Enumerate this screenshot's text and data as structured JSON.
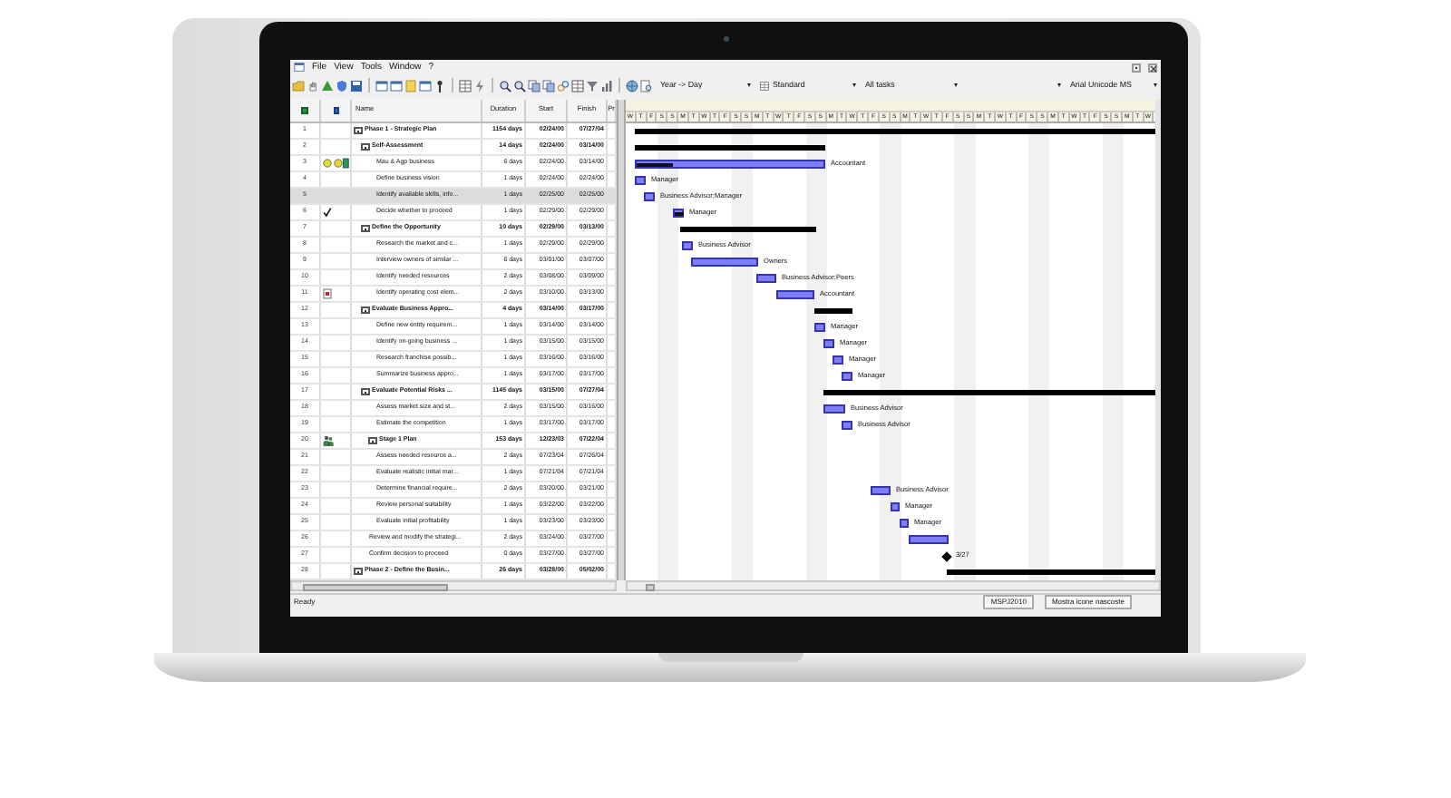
{
  "menu": {
    "items": [
      "File",
      "View",
      "Tools",
      "Window",
      "?"
    ]
  },
  "toolbar": {
    "dropdowns": [
      {
        "kind": "text",
        "value": "Year -> Day"
      },
      {
        "kind": "icon-text",
        "value": "Standard"
      },
      {
        "kind": "text",
        "value": "All tasks"
      },
      {
        "kind": "blank"
      },
      {
        "kind": "text",
        "value": "Arial Unicode MS"
      }
    ]
  },
  "table": {
    "columns": [
      "Name",
      "Duration",
      "Start",
      "Finish",
      "Pr"
    ],
    "rows": [
      {
        "id": "1",
        "name": "Phase 1 - Strategic Plan",
        "duration": "1154 days",
        "start": "02/24/00",
        "finish": "07/27/04",
        "selected": false,
        "expanded": true,
        "bar": {
          "kind": "summary"
        },
        "children": [
          {
            "id": "2",
            "name": "Self-Assessment",
            "duration": "14 days",
            "start": "02/24/00",
            "finish": "03/14/00",
            "selected": false,
            "expanded": true,
            "bar": {
              "kind": "summary"
            },
            "children": [
              {
                "id": "3",
                "name": "Mau & Agp business",
                "duration": "6 days",
                "start": "02/24/00",
                "finish": "03/14/00",
                "selected": false,
                "indicators": [
                  {
                    "kind": "bulb"
                  },
                  {
                    "kind": "bulb"
                  },
                  {
                    "kind": "person"
                  }
                ],
                "bar": {
                  "kind": "task",
                  "level": 0.2,
                  "label": "Accountant"
                }
              },
              {
                "id": "4",
                "name": "Define business vision",
                "duration": "1 days",
                "start": "02/24/00",
                "finish": "02/24/00",
                "selected": false,
                "bar": {
                  "kind": "task",
                  "label": "Manager"
                }
              },
              {
                "id": "5",
                "name": "Identify available skills, info...",
                "duration": "1 days",
                "start": "02/25/00",
                "finish": "02/25/00",
                "selected": true,
                "bar": {
                  "kind": "task",
                  "label": "Business Advisor;Manager"
                }
              },
              {
                "id": "6",
                "name": "Decide whether to proceed",
                "duration": "1 days",
                "start": "02/29/00",
                "finish": "02/29/00",
                "selected": false,
                "indicators": [
                  {
                    "kind": "complete"
                  }
                ],
                "bar": {
                  "kind": "task",
                  "level": 1,
                  "label": "Manager"
                }
              }
            ]
          },
          {
            "id": "7",
            "name": "Define the Opportunity",
            "duration": "10 days",
            "start": "02/29/00",
            "finish": "03/13/00",
            "selected": false,
            "expanded": true,
            "bar": {
              "kind": "summary"
            },
            "children": [
              {
                "id": "8",
                "name": "Research the market and c...",
                "duration": "1 days",
                "start": "02/29/00",
                "finish": "02/29/00",
                "selected": false,
                "bar": {
                  "kind": "task",
                  "label": "Business Advisor"
                }
              },
              {
                "id": "9",
                "name": "Interview owners of similar ...",
                "duration": "6 days",
                "start": "03/01/00",
                "finish": "03/07/00",
                "selected": false,
                "bar": {
                  "kind": "task",
                  "label": "Owners"
                }
              },
              {
                "id": "10",
                "name": "Identify needed resources",
                "duration": "2 days",
                "start": "03/08/00",
                "finish": "03/09/00",
                "selected": false,
                "bar": {
                  "kind": "task",
                  "label": "Business Advisor;Peers"
                }
              },
              {
                "id": "11",
                "name": "Identify operating cost elem...",
                "duration": "2 days",
                "start": "03/10/00",
                "finish": "03/13/00",
                "selected": false,
                "indicators": [
                  {
                    "kind": "note"
                  }
                ],
                "bar": {
                  "kind": "task",
                  "label": "Accountant"
                }
              }
            ]
          },
          {
            "id": "12",
            "name": "Evaluate Business Appro...",
            "duration": "4 days",
            "start": "03/14/00",
            "finish": "03/17/00",
            "selected": false,
            "expanded": true,
            "bar": {
              "kind": "summary"
            },
            "children": [
              {
                "id": "13",
                "name": "Define new entity requirem...",
                "duration": "1 days",
                "start": "03/14/00",
                "finish": "03/14/00",
                "selected": false,
                "bar": {
                  "kind": "task",
                  "label": "Manager"
                }
              },
              {
                "id": "14",
                "name": "Identify on-going business ...",
                "duration": "1 days",
                "start": "03/15/00",
                "finish": "03/15/00",
                "selected": false,
                "bar": {
                  "kind": "task",
                  "label": "Manager"
                }
              },
              {
                "id": "15",
                "name": "Research franchise possib...",
                "duration": "1 days",
                "start": "03/16/00",
                "finish": "03/16/00",
                "selected": false,
                "bar": {
                  "kind": "task",
                  "label": "Manager"
                }
              },
              {
                "id": "16",
                "name": "Summarize business appro...",
                "duration": "1 days",
                "start": "03/17/00",
                "finish": "03/17/00",
                "selected": false,
                "bar": {
                  "kind": "task",
                  "label": "Manager"
                }
              }
            ]
          },
          {
            "id": "17",
            "name": "Evaluate Potential Risks ...",
            "duration": "1145 days",
            "start": "03/15/00",
            "finish": "07/27/04",
            "selected": false,
            "expanded": true,
            "bar": {
              "kind": "summary"
            },
            "children": [
              {
                "id": "18",
                "name": "Assess market size and st...",
                "duration": "2 days",
                "start": "03/15/00",
                "finish": "03/16/00",
                "selected": false,
                "bar": {
                  "kind": "task",
                  "label": "Business Advisor"
                }
              },
              {
                "id": "19",
                "name": "Estimate the competition",
                "duration": "1 days",
                "start": "03/17/00",
                "finish": "03/17/00",
                "selected": false,
                "bar": {
                  "kind": "task",
                  "label": "Business Advisor"
                }
              },
              {
                "id": "20",
                "name": "Stage 1 Plan",
                "duration": "153 days",
                "start": "12/23/03",
                "finish": "07/22/04",
                "selected": false,
                "expanded": true,
                "indicators": [
                  {
                    "kind": "people"
                  }
                ]
              },
              {
                "id": "21",
                "name": "Assess needed resource a...",
                "duration": "2 days",
                "start": "07/23/04",
                "finish": "07/26/04",
                "selected": false
              },
              {
                "id": "22",
                "name": "Evaluate realistic initial mar...",
                "duration": "1 days",
                "start": "07/21/04",
                "finish": "07/21/04",
                "selected": false
              },
              {
                "id": "23",
                "name": "Determine financial require...",
                "duration": "2 days",
                "start": "03/20/00",
                "finish": "03/21/00",
                "selected": false,
                "bar": {
                  "kind": "task",
                  "label": "Business Advisor"
                }
              },
              {
                "id": "24",
                "name": "Review personal suitability",
                "duration": "1 days",
                "start": "03/22/00",
                "finish": "03/22/00",
                "selected": false,
                "bar": {
                  "kind": "task",
                  "label": "Manager"
                }
              },
              {
                "id": "25",
                "name": "Evaluate initial profitability",
                "duration": "1 days",
                "start": "03/23/00",
                "finish": "03/23/00",
                "selected": false,
                "bar": {
                  "kind": "task",
                  "label": "Manager"
                }
              }
            ]
          },
          {
            "id": "26",
            "name": "Review and modify the strategi...",
            "duration": "2 days",
            "start": "03/24/00",
            "finish": "03/27/00",
            "selected": false,
            "bar": {
              "kind": "task"
            }
          },
          {
            "id": "27",
            "name": "Confirm decision to proceed",
            "duration": "0 days",
            "start": "03/27/00",
            "finish": "03/27/00",
            "selected": false,
            "bar": {
              "kind": "milestone",
              "label": "3/27"
            }
          }
        ]
      },
      {
        "id": "28",
        "name": "Phase 2 - Define the Busin...",
        "duration": "26 days",
        "start": "03/28/00",
        "finish": "05/02/00",
        "selected": false,
        "expanded": true,
        "bar": {
          "kind": "summary"
        }
      }
    ]
  },
  "gantt": {
    "timescale": [
      "W",
      "T",
      "F",
      "S",
      "S",
      "M",
      "T",
      "W",
      "T",
      "F",
      "S",
      "S",
      "M",
      "T",
      "W",
      "T",
      "F",
      "S",
      "S",
      "M",
      "T",
      "W",
      "T",
      "F",
      "S",
      "S",
      "M",
      "T",
      "W",
      "T",
      "F",
      "S",
      "S",
      "M",
      "T",
      "W",
      "T",
      "F",
      "S",
      "S",
      "M",
      "T",
      "W",
      "T",
      "F",
      "S",
      "S",
      "M",
      "T",
      "W"
    ]
  },
  "status_bar": {
    "text": "Ready",
    "panels": [
      "MSPJ2010",
      "Mostra icone nascoste"
    ]
  }
}
